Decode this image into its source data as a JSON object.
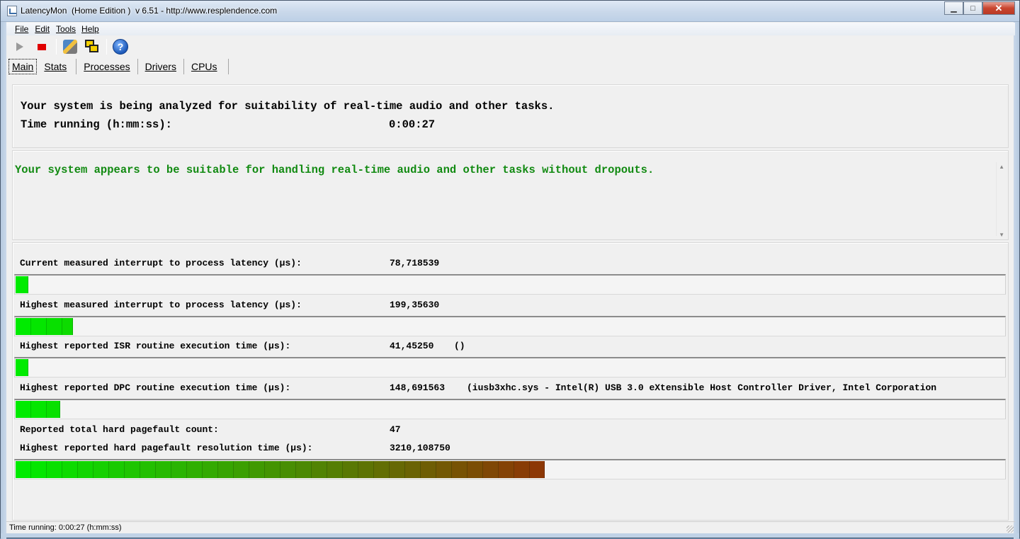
{
  "window": {
    "title": "LatencyMon  (Home Edition )  v 6.51 - http://www.resplendence.com",
    "minimize": "▁",
    "maximize": "□",
    "close": "✕"
  },
  "menu": [
    "File",
    "Edit",
    "Tools",
    "Help"
  ],
  "toolbar": {
    "help_glyph": "?"
  },
  "tabs": [
    "Main",
    "Stats",
    "Processes",
    "Drivers",
    "CPUs"
  ],
  "analysis": {
    "line1": "Your system is being analyzed for suitability of real-time audio and other tasks.",
    "time_label": "Time running (h:mm:ss):",
    "time_value": "0:00:27"
  },
  "verdict": "Your system appears to be suitable for handling real-time audio and other tasks without dropouts.",
  "metrics": {
    "current_latency_label": "Current measured interrupt to process latency (µs):",
    "current_latency_value": "78,718539",
    "current_latency_fill": 0.013,
    "highest_latency_label": "Highest measured interrupt to process latency (µs):",
    "highest_latency_value": "199,35630",
    "highest_latency_fill": 0.058,
    "isr_label": "Highest reported ISR routine execution time (µs):",
    "isr_value": "41,45250",
    "isr_driver": "()",
    "isr_fill": 0.013,
    "dpc_label": "Highest reported DPC routine execution time (µs):",
    "dpc_value": "148,691563",
    "dpc_driver": "(iusb3xhc.sys - Intel(R) USB 3.0 eXtensible Host Controller Driver, Intel Corporation",
    "dpc_fill": 0.045,
    "pagefault_count_label": "Reported total hard pagefault count:",
    "pagefault_count_value": "47",
    "pagefault_time_label": "Highest reported hard pagefault resolution time (µs):",
    "pagefault_time_value": "3210,108750",
    "pagefault_time_fill": 0.535
  },
  "statusbar": "Time running: 0:00:27  (h:mm:ss)"
}
